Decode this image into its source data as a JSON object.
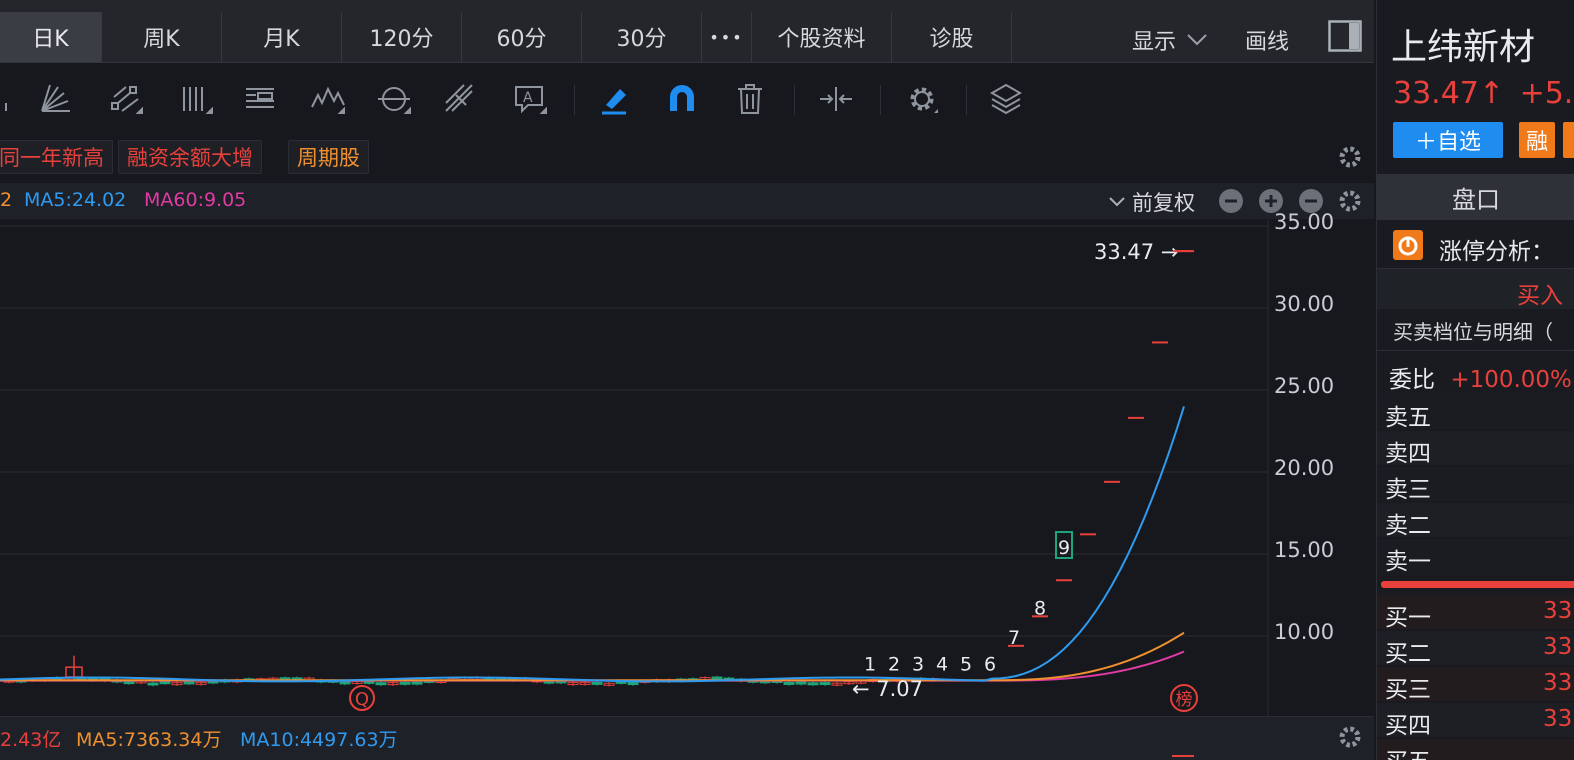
{
  "tabs": {
    "items": [
      {
        "label": "日K",
        "active": true
      },
      {
        "label": "周K",
        "active": false
      },
      {
        "label": "月K",
        "active": false
      },
      {
        "label": "120分",
        "active": false
      },
      {
        "label": "60分",
        "active": false
      },
      {
        "label": "30分",
        "active": false
      },
      {
        "label": "•••",
        "active": false
      },
      {
        "label": "个股资料",
        "active": false
      },
      {
        "label": "诊股",
        "active": false
      }
    ],
    "display_label": "显示",
    "draw_label": "画线"
  },
  "tags": [
    "同一年新高",
    "融资余额大增",
    "周期股"
  ],
  "ma_bar": {
    "ma_prefix": "2",
    "ma5": "MA5:24.02",
    "ma60": "MA60:9.05",
    "adjust_label": "前复权"
  },
  "chart_data": {
    "type": "candlestick",
    "yticks": [
      "35.00",
      "30.00",
      "25.00",
      "20.00",
      "15.00",
      "10.00"
    ],
    "ylim": [
      6,
      35.2
    ],
    "last_price_label": "33.47",
    "low_label": "7.07",
    "counter_labels": [
      "1",
      "2",
      "3",
      "4",
      "5",
      "6",
      "7",
      "8",
      "9"
    ],
    "marker_q": "Q",
    "marker_rank": "榜",
    "limit_up_closes": [
      9.4,
      11.2,
      13.4,
      16.2,
      19.4,
      23.3,
      27.9,
      33.47
    ]
  },
  "volume_bar": {
    "vol": "2.43亿",
    "ma5": "MA5:7363.34万",
    "ma10": "MA10:4497.63万"
  },
  "right_panel": {
    "stock_name": "上纬新材",
    "price": "33.47↑",
    "change": "+5.",
    "add_watch": "＋自选",
    "margin_badge": "融",
    "tab_label": "盘口",
    "limit_analysis": "涨停分析：",
    "buy_header": "买入",
    "detail_title": "买卖档位与明细（",
    "weibi_label": "委比",
    "weibi_value": "+100.00%",
    "sell_levels": [
      "卖五",
      "卖四",
      "卖三",
      "卖二",
      "卖一"
    ],
    "buy_levels": [
      "买一",
      "买二",
      "买三",
      "买四",
      "买五"
    ],
    "buy_prices": [
      "33",
      "33",
      "33",
      "33",
      ""
    ]
  },
  "colors": {
    "up": "#e8413c",
    "down": "#1fa37a",
    "ma5": "#2f9bf0",
    "ma10": "#f0902f",
    "ma60": "#e03aa3",
    "accent_blue": "#1f8cf0",
    "accent_orange": "#f07a1a"
  }
}
